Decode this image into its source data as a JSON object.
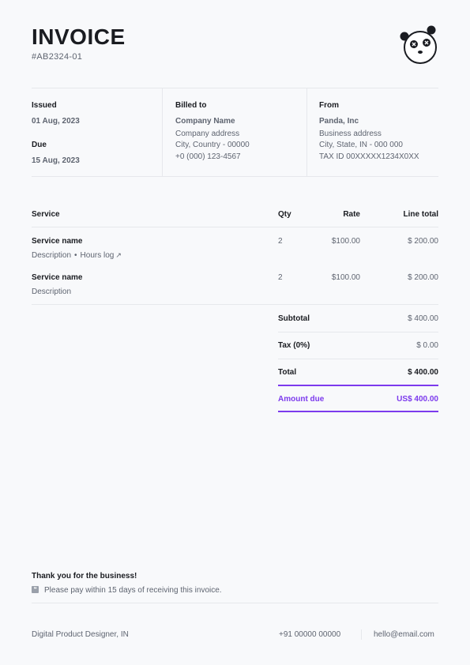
{
  "header": {
    "title": "INVOICE",
    "invoice_number": "#AB2324-01"
  },
  "meta": {
    "issued_label": "Issued",
    "issued_date": "01 Aug, 2023",
    "due_label": "Due",
    "due_date": "15 Aug, 2023"
  },
  "billed_to": {
    "label": "Billed to",
    "name": "Company Name",
    "address": "Company address",
    "city": "City, Country - 00000",
    "phone": "+0 (000) 123-4567"
  },
  "from": {
    "label": "From",
    "name": "Panda, Inc",
    "address": "Business address",
    "city": "City, State, IN - 000 000",
    "tax_id": "TAX ID 00XXXXX1234X0XX"
  },
  "table": {
    "headers": {
      "service": "Service",
      "qty": "Qty",
      "rate": "Rate",
      "total": "Line total"
    },
    "rows": [
      {
        "name": "Service name",
        "description": "Description",
        "extra": "Hours log",
        "qty": "2",
        "rate": "$100.00",
        "total": "$ 200.00"
      },
      {
        "name": "Service name",
        "description": "Description",
        "qty": "2",
        "rate": "$100.00",
        "total": "$ 200.00"
      }
    ]
  },
  "summary": {
    "subtotal_label": "Subtotal",
    "subtotal": "$ 400.00",
    "tax_label": "Tax (0%)",
    "tax": "$ 0.00",
    "total_label": "Total",
    "total": "$ 400.00",
    "due_label": "Amount due",
    "due": "US$ 400.00"
  },
  "notes": {
    "thanks": "Thank you for the business!",
    "payment_note": "Please pay within 15 days of receiving this invoice."
  },
  "footer": {
    "role": "Digital Product Designer, IN",
    "phone": "+91 00000 00000",
    "email": "hello@email.com"
  },
  "colors": {
    "accent": "#7c3aed",
    "text": "#1a1c21",
    "muted": "#5e6470",
    "divider": "#e6e8ec"
  },
  "icons": {
    "logo": "panda-logo-icon",
    "external_link": "arrow-up-right-icon",
    "note": "quote-icon"
  }
}
